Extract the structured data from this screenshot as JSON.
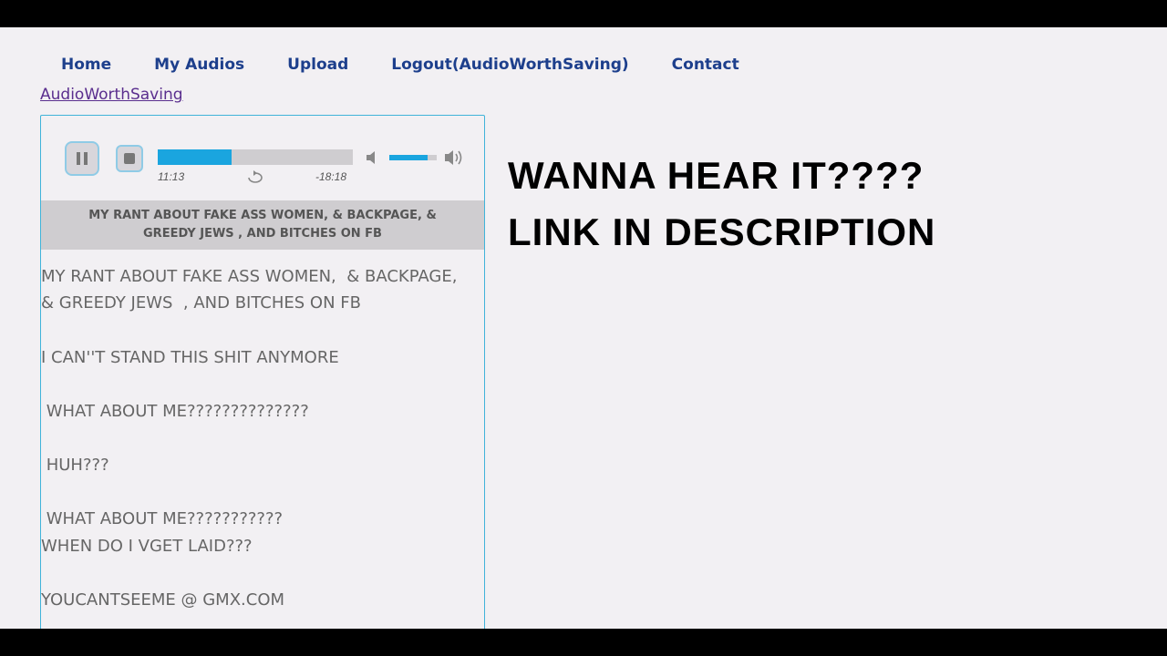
{
  "nav": {
    "items": [
      {
        "label": "Home"
      },
      {
        "label": "My Audios"
      },
      {
        "label": "Upload"
      },
      {
        "label": "Logout(AudioWorthSaving)"
      },
      {
        "label": "Contact"
      }
    ],
    "user_link": "AudioWorthSaving"
  },
  "player": {
    "current_time": "11:13",
    "remaining_time": "-18:18",
    "progress_fraction": 0.38,
    "volume_fraction": 0.8,
    "accent_color": "#1aa5df",
    "icons": [
      "pause-icon",
      "stop-icon",
      "loop-icon",
      "volume-mute-icon",
      "volume-max-icon"
    ]
  },
  "audio": {
    "title": "MY RANT ABOUT FAKE ASS WOMEN, & BACKPAGE, & GREEDY JEWS , AND BITCHES ON FB",
    "description_lines": [
      "MY RANT ABOUT FAKE ASS WOMEN,  & BACKPAGE,",
      "& GREEDY JEWS  , AND BITCHES ON FB",
      "I CAN''T STAND THIS SHIT ANYMORE",
      " WHAT ABOUT ME??????????????",
      " HUH???",
      " WHAT ABOUT ME???????????",
      "WHEN DO I VGET LAID???",
      "YOUCANTSEEME @ GMX.COM"
    ]
  },
  "promo": {
    "line1": "WANNA HEAR IT????",
    "line2": "LINK IN DESCRIPTION"
  }
}
